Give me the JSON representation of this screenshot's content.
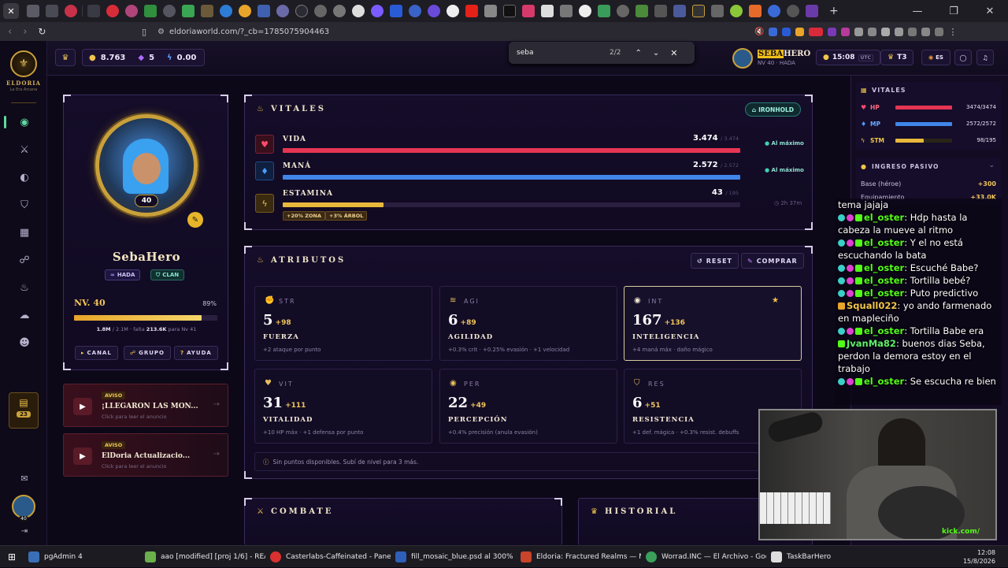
{
  "browser": {
    "url": "eldoriaworld.com/?_cb=1785075904463",
    "find": {
      "query": "seba",
      "count": "2/2"
    },
    "window_controls": [
      "—",
      "❐",
      "✕"
    ]
  },
  "sidebar": {
    "logo_title": "ELDORIA",
    "logo_subtitle": "La Era Arcana",
    "badge_count": "23",
    "avatar_level": "40"
  },
  "topbar": {
    "gold": "8.763",
    "gems": "5",
    "energy": "0.00",
    "player_name_highlight": "SEBA",
    "player_name_rest": "HERO",
    "player_sub": "NV 40 · HADA",
    "time": "15:08",
    "timezone": "UTC",
    "tier": "T3",
    "lang": "ES"
  },
  "profile": {
    "name": "SebaHero",
    "avatar_level": "40",
    "tags": [
      "HADA",
      "CLAN"
    ],
    "level_label": "NV. 40",
    "xp_percent_label": "89%",
    "xp_fraction": 0.89,
    "xp_current": "1.8M",
    "xp_total": "/ 2.1M",
    "xp_missing_prefix": "· falta",
    "xp_missing": "213.6K",
    "xp_next": "para Nv 41",
    "buttons": [
      "CANAL",
      "GRUPO",
      "AYUDA"
    ]
  },
  "notices": [
    {
      "tag": "AVISO",
      "title": "¡LLEGARON LAS MON...",
      "subtitle": "Click para leer el anuncio"
    },
    {
      "tag": "AVISO",
      "title": "ElDoria Actualizacio...",
      "subtitle": "Click para leer el anuncio"
    }
  ],
  "vitals": {
    "title": "VITALES",
    "region": "IRONHOLD",
    "rows": [
      {
        "label": "VIDA",
        "value": "3.474",
        "max": "/ 3.474",
        "status": "Al máximo",
        "fill": 1.0,
        "color": "#e63553"
      },
      {
        "label": "MANÁ",
        "value": "2.572",
        "max": "/ 2.572",
        "status": "Al máximo",
        "fill": 1.0,
        "color": "#3f86e8"
      },
      {
        "label": "ESTAMINA",
        "value": "43",
        "max": "/ 195",
        "status": "2h 37m",
        "fill": 0.22,
        "color": "#e8b83b"
      }
    ],
    "buffs": [
      "+20% ZONA",
      "+3% ÁRBOL"
    ]
  },
  "attributes": {
    "title": "ATRIBUTOS",
    "reset_label": "RESET",
    "buy_label": "COMPRAR",
    "items": [
      {
        "abbr": "STR",
        "value": "5",
        "bonus": "+98",
        "name": "FUERZA",
        "desc": "+2 ataque por punto"
      },
      {
        "abbr": "AGI",
        "value": "6",
        "bonus": "+89",
        "name": "AGILIDAD",
        "desc": "+0.3% crit · +0.25% evasión · +1 velocidad"
      },
      {
        "abbr": "INT",
        "value": "167",
        "bonus": "+136",
        "name": "INTELIGENCIA",
        "desc": "+4 maná máx · daño mágico"
      },
      {
        "abbr": "VIT",
        "value": "31",
        "bonus": "+111",
        "name": "VITALIDAD",
        "desc": "+10 HP máx · +1 defensa por punto"
      },
      {
        "abbr": "PER",
        "value": "22",
        "bonus": "+49",
        "name": "PERCEPCIÓN",
        "desc": "+0.4% precisión (anula evasión)"
      },
      {
        "abbr": "RES",
        "value": "6",
        "bonus": "+51",
        "name": "RESISTENCIA",
        "desc": "+1 def. mágica · +0.3% resist. debuffs"
      }
    ],
    "footer": "Sin puntos disponibles. Subí de nivel para 3 más."
  },
  "lower_panels": {
    "combat": "COMBATE",
    "history": "HISTORIAL"
  },
  "right_panel": {
    "vitals_title": "VITALES",
    "rows": [
      {
        "label": "HP",
        "value": "3474/3474",
        "fill": 1.0,
        "color": "#e63553"
      },
      {
        "label": "MP",
        "value": "2572/2572",
        "fill": 1.0,
        "color": "#3f86e8"
      },
      {
        "label": "STM",
        "value": "98/195",
        "fill": 0.5,
        "color": "#e8b83b"
      }
    ],
    "income_title": "INGRESO PASIVO",
    "income_rows": [
      {
        "label": "Base (héroe)",
        "value": "+300"
      },
      {
        "label": "Equipamiento",
        "value": "+33.0K"
      }
    ]
  },
  "chat": [
    {
      "user": "",
      "text": "tema jajaja"
    },
    {
      "user": "el_oster",
      "text": "Hdp hasta la cabeza la mueve al ritmo"
    },
    {
      "user": "el_oster",
      "text": "Y el no está escuchando la bata"
    },
    {
      "user": "el_oster",
      "text": "Escuché Babe?"
    },
    {
      "user": "el_oster",
      "text": "Tortilla bebé?"
    },
    {
      "user": "el_oster",
      "text": "Puto predictivo"
    },
    {
      "user": "Squall022",
      "text": "yo ando farmenado en mapleciño"
    },
    {
      "user": "el_oster",
      "text": "Tortilla Babe era"
    },
    {
      "user": "JvanMa82",
      "text": "buenos dias Seba, perdon la demora estoy en el trabajo"
    },
    {
      "user": "el_oster",
      "text": "Se escucha re bien"
    }
  ],
  "webcam": {
    "watermark": "kick.com/"
  },
  "taskbar": {
    "items": [
      {
        "label": "pgAdmin 4",
        "color": "#3a6fb8"
      },
      {
        "label": "aao [modified] [proj 1/6] - REAPE...",
        "color": "#6bb04a"
      },
      {
        "label": "Casterlabs-Caffeinated - Panel de ...",
        "color": "#d8312f"
      },
      {
        "label": "fill_mosaic_blue.psd al 300% (Gree...",
        "color": "#2f5fb8"
      },
      {
        "label": "Eldoria: Fractured Realms — MM...",
        "color": "#c8442a"
      },
      {
        "label": "Worrad.INC — El Archivo - Googl...",
        "color": "#3aa05a"
      },
      {
        "label": "TaskBarHero",
        "color": "#dddddd"
      }
    ],
    "clock_time": "12:08",
    "clock_date": "15/8/2026"
  }
}
